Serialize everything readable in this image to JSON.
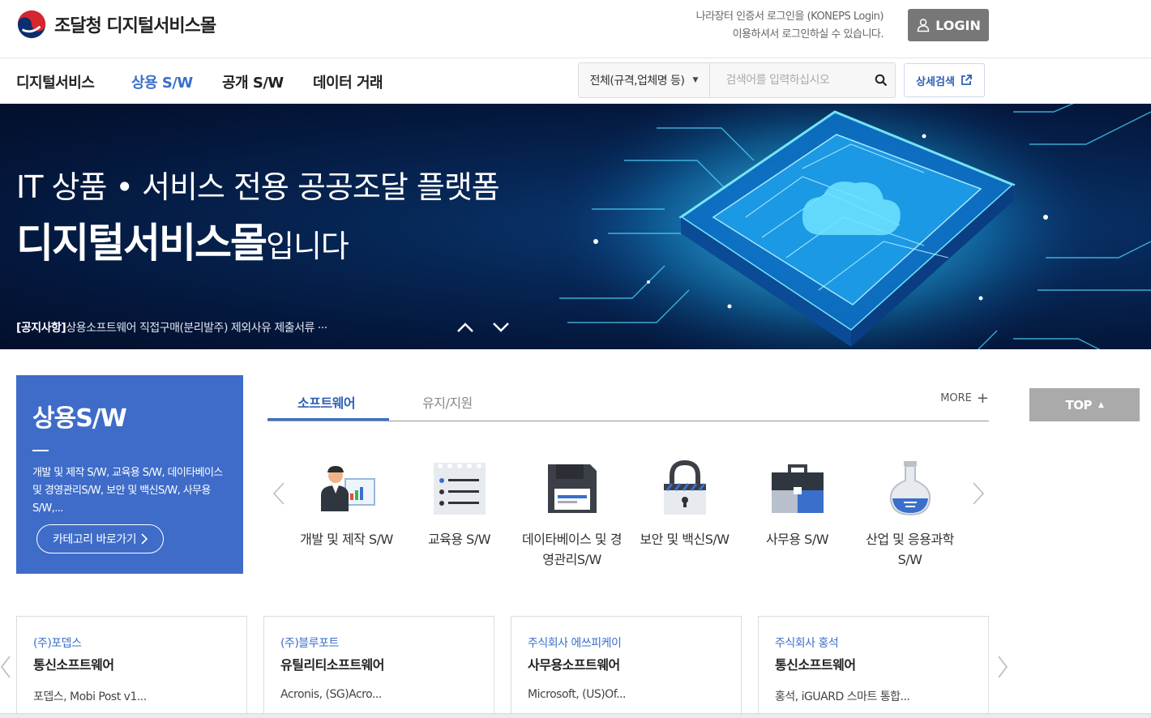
{
  "header": {
    "logo_text": "조달청 디지털서비스몰",
    "login_info_line1": "나라장터 인증서 로그인을 (KONEPS Login)",
    "login_info_line2": "이용하셔서 로그인하실 수 있습니다.",
    "login_label": "LOGIN"
  },
  "nav": {
    "items": [
      {
        "label": "디지털서비스",
        "active": false
      },
      {
        "label": "상용 S/W",
        "active": true
      },
      {
        "label": "공개 S/W",
        "active": false
      },
      {
        "label": "데이터 거래",
        "active": false
      }
    ],
    "search_scope": "전체(규격,업체명 등)",
    "search_placeholder": "검색어를 입력하십시오",
    "advanced_search_label": "상세검색"
  },
  "hero": {
    "subtitle": "IT 상품 • 서비스 전용 공공조달 플랫폼",
    "title_strong": "디지털서비스몰",
    "title_rest": "입니다",
    "notice_tag": "[공지사항]",
    "notice_text": "상용소프트웨어 직접구매(분리발주) 제외사유 제출서류 ···"
  },
  "category_card": {
    "title": "상용S/W",
    "description": "개발 및 제작 S/W, 교육용 S/W, 데이타베이스 및 경영관리S/W, 보안 및 백신S/W, 사무용 S/W,...",
    "button_label": "카테고리 바로가기"
  },
  "tabs": {
    "items": [
      {
        "label": "소프트웨어",
        "active": true
      },
      {
        "label": "유지/지원",
        "active": false
      }
    ],
    "more_label": "MORE"
  },
  "top_button_label": "TOP",
  "categories": [
    {
      "label": "개발 및 제작 S/W",
      "icon": "developer-icon"
    },
    {
      "label": "교육용 S/W",
      "icon": "notepad-icon"
    },
    {
      "label": "데이타베이스 및 경영관리S/W",
      "icon": "floppy-disk-icon"
    },
    {
      "label": "보안 및 백신S/W",
      "icon": "padlock-icon"
    },
    {
      "label": "사무용 S/W",
      "icon": "briefcase-icon"
    },
    {
      "label": "산업 및 응용과학 S/W",
      "icon": "flask-icon"
    }
  ],
  "products": [
    {
      "vendor": "(주)포뎁스",
      "category": "통신소프트웨어",
      "desc": "포뎁스, Mobi Post v1..."
    },
    {
      "vendor": "(주)블루포트",
      "category": "유틸리티소프트웨어",
      "desc": "Acronis, (SG)Acro..."
    },
    {
      "vendor": "주식회사 에쓰피케이",
      "category": "사무용소프트웨어",
      "desc": "Microsoft, (US)Of..."
    },
    {
      "vendor": "주식회사 홍석",
      "category": "통신소프트웨어",
      "desc": "홍석, iGUARD 스마트 통합..."
    }
  ],
  "colors": {
    "accent": "#3a6fcb",
    "card_blue": "#3e6cc8",
    "login_bg": "#777777",
    "top_bg": "#aaaaaa"
  }
}
